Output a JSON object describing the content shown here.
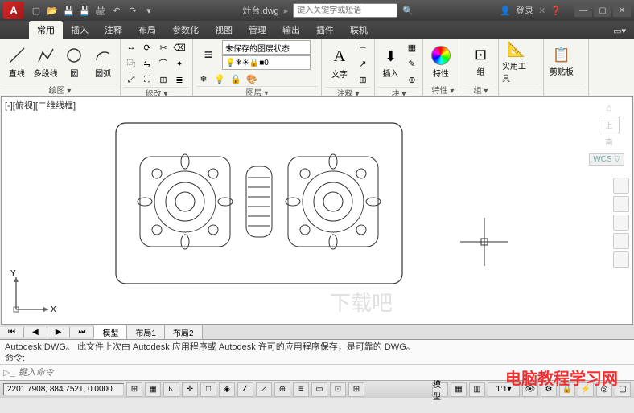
{
  "title": {
    "filename": "灶台.dwg",
    "search_placeholder": "键入关键字或短语",
    "login": "登录"
  },
  "tabs": [
    "常用",
    "插入",
    "注释",
    "布局",
    "参数化",
    "视图",
    "管理",
    "输出",
    "插件",
    "联机"
  ],
  "active_tab": 0,
  "panels": {
    "draw": {
      "label": "绘图 ▾",
      "line": "直线",
      "polyline": "多段线",
      "circle": "圆",
      "arc": "圆弧"
    },
    "modify": {
      "label": "修改 ▾"
    },
    "layers": {
      "label": "图层 ▾",
      "state": "未保存的图层状态",
      "current": "0"
    },
    "annotation": {
      "label": "注释 ▾",
      "text": "文字"
    },
    "block": {
      "label": "块 ▾",
      "insert": "插入"
    },
    "properties": {
      "label": "特性 ▾",
      "btn": "特性"
    },
    "groups": {
      "label": "组 ▾",
      "btn": "组"
    },
    "utilities": {
      "label": "实用工具",
      "btn": "实用工具"
    },
    "clipboard": {
      "label": "剪贴板",
      "btn": "剪贴板"
    }
  },
  "viewport": {
    "label": "[-][俯视][二维线框]",
    "wcs": "WCS ▽",
    "cube": "上",
    "axis_x": "X",
    "axis_y": "Y"
  },
  "footer_tabs": [
    "模型",
    "布局1",
    "布局2"
  ],
  "active_footer": 0,
  "cmd": {
    "history1": "Autodesk DWG。  此文件上次由 Autodesk 应用程序或 Autodesk 许可的应用程序保存，是可靠的 DWG。",
    "history2": "命令:",
    "placeholder": "键入命令"
  },
  "status": {
    "coords": "2201.7908, 884.7521, 0.0000",
    "scale": "1:1"
  },
  "watermark": "电脑教程学习网",
  "watermark2": "下载吧"
}
